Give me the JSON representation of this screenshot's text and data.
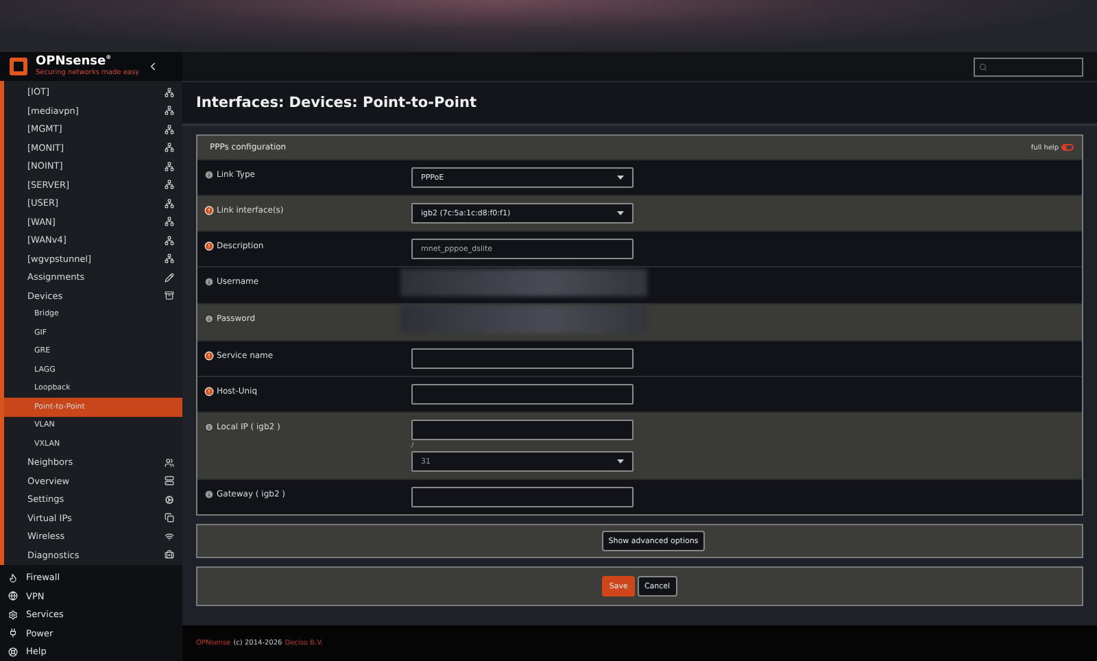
{
  "brand": {
    "name": "OPNsense",
    "mark": "®",
    "tagline": "Securing networks made easy"
  },
  "sidebar": {
    "section_items": [
      {
        "label": "[IOT]"
      },
      {
        "label": "[mediavpn]"
      },
      {
        "label": "[MGMT]"
      },
      {
        "label": "[MONIT]"
      },
      {
        "label": "[NOINT]"
      },
      {
        "label": "[SERVER]"
      },
      {
        "label": "[USER]"
      },
      {
        "label": "[WAN]"
      },
      {
        "label": "[WANv4]"
      },
      {
        "label": "[wgvpstunnel]"
      },
      {
        "label": "Assignments"
      },
      {
        "label": "Devices",
        "expanded": true,
        "children": [
          {
            "label": "Bridge",
            "selected": false
          },
          {
            "label": "GIF",
            "selected": false
          },
          {
            "label": "GRE",
            "selected": false
          },
          {
            "label": "LAGG",
            "selected": false
          },
          {
            "label": "Loopback",
            "selected": false
          },
          {
            "label": "Point-to-Point",
            "selected": true
          },
          {
            "label": "VLAN",
            "selected": false
          },
          {
            "label": "VXLAN",
            "selected": false
          }
        ]
      },
      {
        "label": "Neighbors"
      },
      {
        "label": "Overview"
      },
      {
        "label": "Settings"
      },
      {
        "label": "Virtual IPs"
      },
      {
        "label": "Wireless"
      },
      {
        "label": "Diagnostics"
      }
    ],
    "menu_items": [
      {
        "label": "Firewall"
      },
      {
        "label": "VPN"
      },
      {
        "label": "Services"
      },
      {
        "label": "Power"
      },
      {
        "label": "Help"
      }
    ]
  },
  "page_title": "Interfaces: Devices: Point-to-Point",
  "panel": {
    "title": "PPPs configuration",
    "help_label": "full help",
    "help_on": false,
    "rows": [
      {
        "label": "Link Type",
        "required": false,
        "shaded": false,
        "kind": "select",
        "value": "PPPoE"
      },
      {
        "label": "Link interface(s)",
        "required": true,
        "shaded": true,
        "kind": "select",
        "value": "igb2 (7c:5a:1c:d8:f0:f1)"
      },
      {
        "label": "Description",
        "required": true,
        "shaded": false,
        "kind": "text",
        "value": "mnet_pppoe_dslite"
      },
      {
        "label": "Username",
        "required": false,
        "shaded": false,
        "kind": "redacted"
      },
      {
        "label": "Password",
        "required": false,
        "shaded": true,
        "kind": "redacted"
      },
      {
        "label": "Service name",
        "required": true,
        "shaded": false,
        "kind": "text"
      },
      {
        "label": "Host-Uniq",
        "required": true,
        "shaded": false,
        "kind": "text"
      },
      {
        "label": "Local IP ( igb2 )",
        "required": false,
        "shaded": true,
        "kind": "address",
        "separator": "/",
        "subnet": "31"
      },
      {
        "label": "Gateway ( igb2 )",
        "required": false,
        "shaded": false,
        "kind": "text"
      }
    ]
  },
  "advanced_button": "Show advanced options",
  "buttons": [
    {
      "label": "Save",
      "primary": true
    },
    {
      "label": "Cancel",
      "primary": false
    }
  ],
  "footer": {
    "brand": "OPNsense",
    "text": "(c) 2014-2026",
    "company": "Deciso B.V."
  }
}
